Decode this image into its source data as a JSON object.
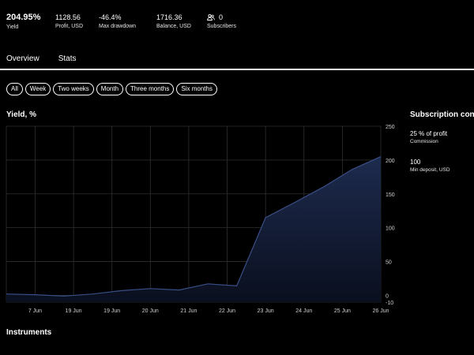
{
  "stats": {
    "yield": {
      "value": "204.95%",
      "label": "Yield"
    },
    "profit": {
      "value": "1128.56",
      "label": "Profit, USD"
    },
    "drawdown": {
      "value": "-46.4%",
      "label": "Max drawdown"
    },
    "balance": {
      "value": "1716.36",
      "label": "Balance, USD"
    },
    "subscribers": {
      "value": "0",
      "label": "Subscribers",
      "icon": "users-icon"
    }
  },
  "tabs": [
    {
      "label": "Overview"
    },
    {
      "label": "Stats"
    }
  ],
  "periods": [
    {
      "label": "All"
    },
    {
      "label": "Week"
    },
    {
      "label": "Two weeks"
    },
    {
      "label": "Month"
    },
    {
      "label": "Three months"
    },
    {
      "label": "Six months"
    }
  ],
  "chart_section": {
    "title": "Yield, %"
  },
  "subscription": {
    "title": "Subscription con",
    "commission": {
      "value": "25 % of profit",
      "label": "Commission"
    },
    "deposit": {
      "value": "100",
      "label": "Min deposit, USD"
    }
  },
  "instruments": {
    "title": "Instruments"
  },
  "chart_data": {
    "type": "area",
    "title": "Yield, %",
    "x": [
      "7 Jun",
      "19 Jun",
      "19 Jun",
      "20 Jun",
      "21 Jun",
      "22 Jun",
      "23 Jun",
      "24 Jun",
      "25 Jun",
      "26 Jun"
    ],
    "series": [
      {
        "values": [
          2,
          0,
          1,
          0,
          -1,
          0,
          2,
          0,
          7,
          0,
          10,
          0,
          8,
          0,
          17,
          0,
          14,
          0,
          115,
          0,
          137,
          0,
          160,
          0,
          186,
          0,
          205
        ]
      }
    ],
    "ylim": [
      -10,
      250
    ],
    "yticks": [
      -10,
      0,
      50,
      100,
      150,
      200,
      250
    ],
    "grid": true,
    "colors": {
      "line": "#3a4f86",
      "fill_top": "#1d2b4e"
    }
  }
}
